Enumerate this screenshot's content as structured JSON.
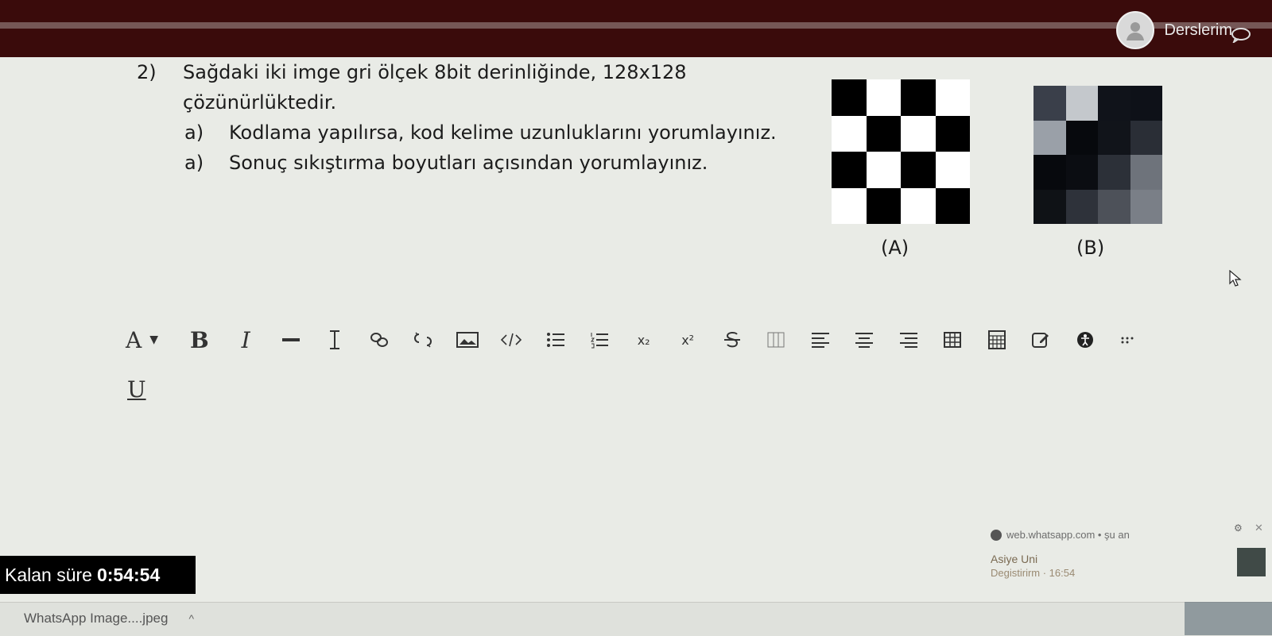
{
  "header": {
    "user_name": "Derslerim"
  },
  "question": {
    "number": "2)",
    "line1": "Sağdaki iki imge gri ölçek 8bit derinliğinde, 128x128",
    "line2": "çözünürlüktedir.",
    "items": [
      {
        "label": "a)",
        "text": "Kodlama yapılırsa, kod kelime uzunluklarını yorumlayınız."
      },
      {
        "label": "a)",
        "text": "Sonuç sıkıştırma boyutları açısından yorumlayınız."
      }
    ]
  },
  "images": {
    "A": {
      "caption": "(A)",
      "cells": [
        "#000000",
        "#ffffff",
        "#000000",
        "#ffffff",
        "#ffffff",
        "#000000",
        "#ffffff",
        "#000000",
        "#000000",
        "#ffffff",
        "#000000",
        "#ffffff",
        "#ffffff",
        "#000000",
        "#ffffff",
        "#000000"
      ]
    },
    "B": {
      "caption": "(B)",
      "cells": [
        "#3a3f4a",
        "#c4c8cc",
        "#10131a",
        "#0e1118",
        "#9aa0a8",
        "#07090d",
        "#11141a",
        "#2a2e36",
        "#07090d",
        "#0b0d12",
        "#2c3038",
        "#6e737b",
        "#0f1216",
        "#2e323a",
        "#4d5159",
        "#7a7f87"
      ]
    }
  },
  "editor": {
    "toolbar": {
      "font_label": "A",
      "bold_label": "B",
      "italic_label": "I",
      "subscript_label": "x₂",
      "superscript_label": "x²"
    },
    "underline_label": "U"
  },
  "timer": {
    "label": "Kalan süre",
    "value": "0:54:54"
  },
  "notification": {
    "source": "web.whatsapp.com • şu an",
    "title": "Asiye Uni",
    "message": "Degistirirm · 16:54"
  },
  "downloads": {
    "file_name": "WhatsApp Image....jpeg"
  }
}
